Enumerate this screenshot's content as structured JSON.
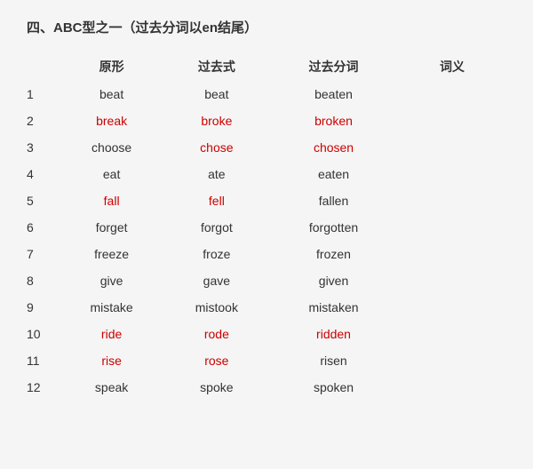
{
  "title": "四、ABC型之一（过去分词以en结尾）",
  "headers": {
    "num": "",
    "base": "原形",
    "past": "过去式",
    "pp": "过去分词",
    "meaning": "词义"
  },
  "rows": [
    {
      "num": "1",
      "base": "beat",
      "base_red": false,
      "past": "beat",
      "past_red": false,
      "pp": "beaten",
      "pp_red": false
    },
    {
      "num": "2",
      "base": "break",
      "base_red": true,
      "past": "broke",
      "past_red": true,
      "pp": "broken",
      "pp_red": true
    },
    {
      "num": "3",
      "base": "choose",
      "base_red": false,
      "past": "chose",
      "past_red": true,
      "pp": "chosen",
      "pp_red": true
    },
    {
      "num": "4",
      "base": "eat",
      "base_red": false,
      "past": "ate",
      "past_red": false,
      "pp": "eaten",
      "pp_red": false
    },
    {
      "num": "5",
      "base": "fall",
      "base_red": true,
      "past": "fell",
      "past_red": true,
      "pp": "fallen",
      "pp_red": false
    },
    {
      "num": "6",
      "base": "forget",
      "base_red": false,
      "past": "forgot",
      "past_red": false,
      "pp": "forgotten",
      "pp_red": false
    },
    {
      "num": "7",
      "base": "freeze",
      "base_red": false,
      "past": "froze",
      "past_red": false,
      "pp": "frozen",
      "pp_red": false
    },
    {
      "num": "8",
      "base": "give",
      "base_red": false,
      "past": "gave",
      "past_red": false,
      "pp": "given",
      "pp_red": false
    },
    {
      "num": "9",
      "base": "mistake",
      "base_red": false,
      "past": "mistook",
      "past_red": false,
      "pp": "mistaken",
      "pp_red": false
    },
    {
      "num": "10",
      "base": "ride",
      "base_red": true,
      "past": "rode",
      "past_red": true,
      "pp": "ridden",
      "pp_red": true
    },
    {
      "num": "11",
      "base": "rise",
      "base_red": true,
      "past": "rose",
      "past_red": true,
      "pp": "risen",
      "pp_red": false
    },
    {
      "num": "12",
      "base": "speak",
      "base_red": false,
      "past": "spoke",
      "past_red": false,
      "pp": "spoken",
      "pp_red": false
    }
  ]
}
